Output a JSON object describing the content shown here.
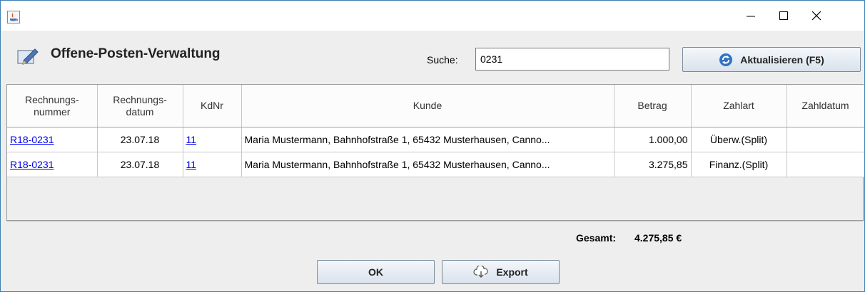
{
  "window": {
    "controls": {
      "minimize": "—",
      "maximize": "☐",
      "close": "✕"
    }
  },
  "header": {
    "title": "Offene-Posten-Verwaltung",
    "search_label": "Suche:",
    "search_value": "0231",
    "refresh_label": "Aktualisieren (F5)"
  },
  "table": {
    "columns": [
      "Rechnungs-\nnummer",
      "Rechnungs-\ndatum",
      "KdNr",
      "Kunde",
      "Betrag",
      "Zahlart",
      "Zahldatum"
    ],
    "rows": [
      {
        "rechnungsnummer": "R18-0231",
        "datum": "23.07.18",
        "kdnr": "11",
        "kunde": "Maria Mustermann, Bahnhofstraße 1, 65432 Musterhausen, Canno...",
        "betrag": "1.000,00",
        "zahlart": "Überw.(Split)",
        "zahldatum": ""
      },
      {
        "rechnungsnummer": "R18-0231",
        "datum": "23.07.18",
        "kdnr": "11",
        "kunde": "Maria Mustermann, Bahnhofstraße 1, 65432 Musterhausen, Canno...",
        "betrag": "3.275,85",
        "zahlart": "Finanz.(Split)",
        "zahldatum": ""
      }
    ]
  },
  "footer": {
    "total_label": "Gesamt:",
    "total_value": "4.275,85 €",
    "ok_label": "OK",
    "export_label": "Export"
  },
  "colors": {
    "link": "#0000ee",
    "window_border": "#3c7fb1",
    "refresh_icon": "#2f73c8"
  }
}
